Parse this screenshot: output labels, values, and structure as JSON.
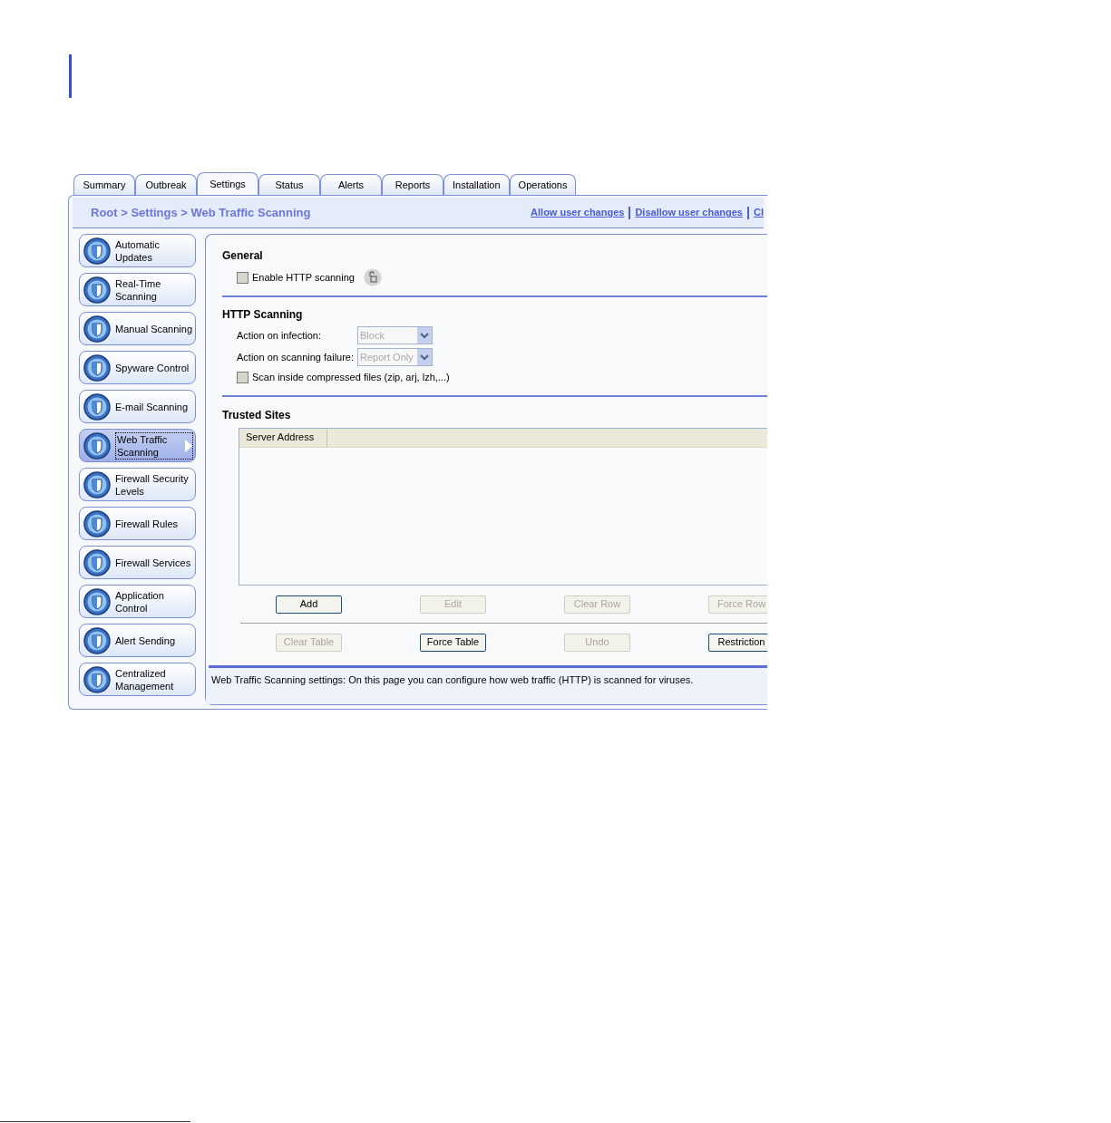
{
  "tabs": [
    {
      "label": "Summary",
      "selected": false
    },
    {
      "label": "Outbreak",
      "selected": false
    },
    {
      "label": "Settings",
      "selected": true
    },
    {
      "label": "Status",
      "selected": false
    },
    {
      "label": "Alerts",
      "selected": false
    },
    {
      "label": "Reports",
      "selected": false
    },
    {
      "label": "Installation",
      "selected": false
    },
    {
      "label": "Operations",
      "selected": false
    }
  ],
  "breadcrumb": "Root > Settings > Web Traffic Scanning",
  "links": [
    "Allow user changes",
    "Disallow user changes",
    "Cl"
  ],
  "sidebar": {
    "items": [
      {
        "label": "Automatic Updates",
        "selected": false
      },
      {
        "label": "Real-Time Scanning",
        "selected": false
      },
      {
        "label": "Manual Scanning",
        "selected": false
      },
      {
        "label": "Spyware Control",
        "selected": false
      },
      {
        "label": "E-mail Scanning",
        "selected": false
      },
      {
        "label": "Web Traffic Scanning",
        "selected": true
      },
      {
        "label": "Firewall Security Levels",
        "selected": false
      },
      {
        "label": "Firewall Rules",
        "selected": false
      },
      {
        "label": "Firewall Services",
        "selected": false
      },
      {
        "label": "Application Control",
        "selected": false
      },
      {
        "label": "Alert Sending",
        "selected": false
      },
      {
        "label": "Centralized Management",
        "selected": false
      }
    ]
  },
  "general": {
    "title": "General",
    "enable_http": {
      "label": "Enable HTTP scanning",
      "checked": false
    }
  },
  "http_scanning": {
    "title": "HTTP Scanning",
    "selects": [
      {
        "label": "Action on infection:",
        "value": "Block",
        "disabled": true
      },
      {
        "label": "Action on scanning failure:",
        "value": "Report Only",
        "disabled": true
      }
    ],
    "compressed": {
      "label": "Scan inside compressed files (zip, arj, lzh,...)",
      "checked": false
    }
  },
  "trusted_sites": {
    "title": "Trusted Sites",
    "columns": [
      "Server Address"
    ],
    "buttons_row1": [
      {
        "label": "Add",
        "disabled": false
      },
      {
        "label": "Edit",
        "disabled": true
      },
      {
        "label": "Clear Row",
        "disabled": true
      },
      {
        "label": "Force Row",
        "disabled": true
      }
    ],
    "buttons_row2": [
      {
        "label": "Clear Table",
        "disabled": true
      },
      {
        "label": "Force Table",
        "disabled": false
      },
      {
        "label": "Undo",
        "disabled": true
      },
      {
        "label": "Restriction",
        "disabled": false
      }
    ]
  },
  "status_bar": "Web Traffic Scanning settings: On this page you can configure how web traffic (HTTP) is scanned for viruses."
}
